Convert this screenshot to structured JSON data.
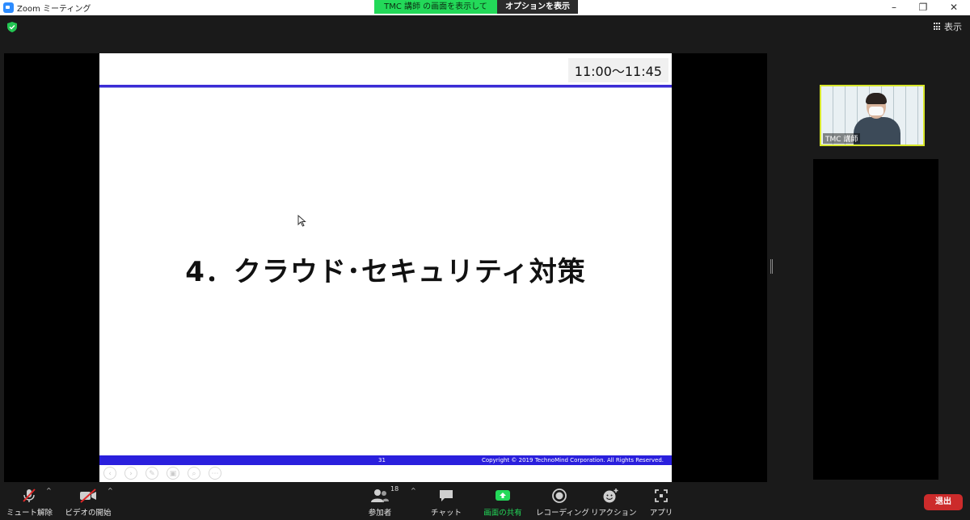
{
  "window": {
    "title": "Zoom ミーティング",
    "controls": [
      "minimize-icon",
      "restore-icon",
      "close-icon"
    ]
  },
  "share_banner": {
    "status": "TMC 講師 の画面を表示しています",
    "options": "オプションを表示 ⌄"
  },
  "top_bar": {
    "view_label": "表示"
  },
  "slide": {
    "time": "11:00〜11:45",
    "heading": "4．クラウド･セキュリティ対策",
    "page_number": "31",
    "copyright": "Copyright © 2019 TechnoMind Corporation. All Rights Reserved.",
    "nav_controls": [
      "prev-icon",
      "next-icon",
      "pen-icon",
      "slides-icon",
      "zoom-icon",
      "more-icon"
    ]
  },
  "participant": {
    "name": "TMC 講師"
  },
  "toolbar": {
    "unmute": "ミュート解除",
    "start_video": "ビデオの開始",
    "participants": "参加者",
    "participants_count": "18",
    "chat": "チャット",
    "share_screen": "画面の共有",
    "recording": "レコーディング",
    "reactions": "リアクション",
    "apps": "アプリ",
    "leave": "退出"
  },
  "colors": {
    "share_green": "#23d959",
    "slide_blue": "#2a1fdd",
    "leave_red": "#cc2b2b",
    "speaker_border": "#d7e62a"
  }
}
